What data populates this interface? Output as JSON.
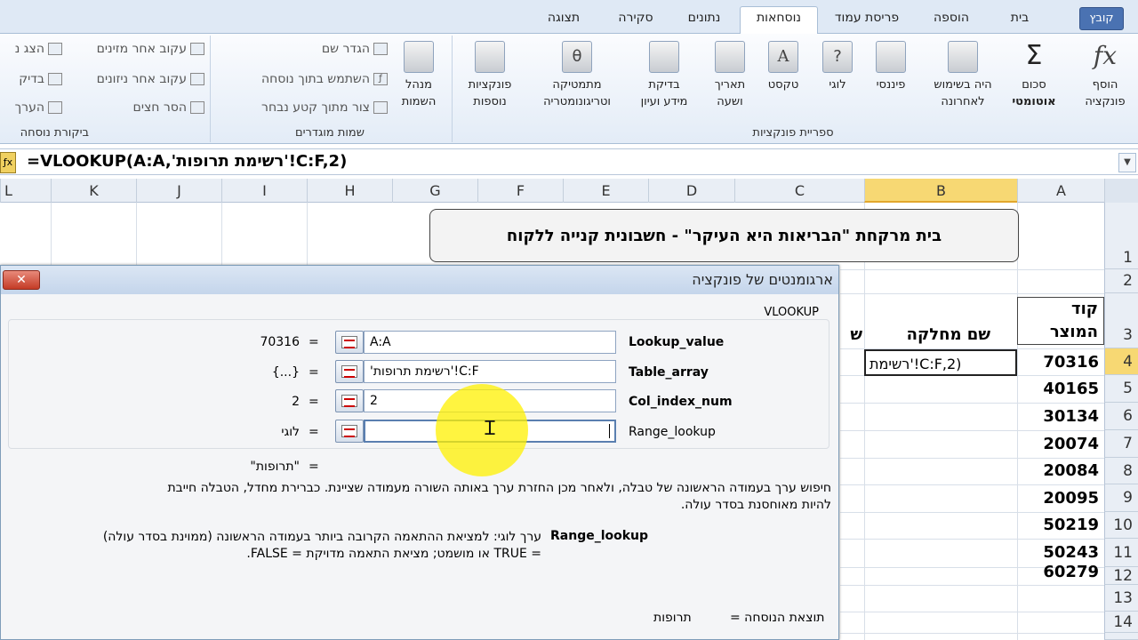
{
  "tabs": {
    "file": "קובץ",
    "items": [
      "בית",
      "הוספה",
      "פריסת עמוד",
      "נוסחאות",
      "נתונים",
      "סקירה",
      "תצוגה"
    ],
    "active": "נוסחאות"
  },
  "ribbon": {
    "function_library": {
      "label": "ספריית פונקציות",
      "buttons": [
        {
          "l1": "הוסף",
          "l2": "פונקציה",
          "icon": "fx"
        },
        {
          "l1": "סכום",
          "l2": "אוטומטי",
          "icon": "Σ"
        },
        {
          "l1": "היה בשימוש",
          "l2": "לאחרונה",
          "icon": "📖"
        },
        {
          "l1": "פיננסי",
          "l2": "",
          "icon": "📖"
        },
        {
          "l1": "לוגי",
          "l2": "",
          "icon": "?"
        },
        {
          "l1": "טקסט",
          "l2": "",
          "icon": "A"
        },
        {
          "l1": "תאריך",
          "l2": "ושעה",
          "icon": "📖"
        },
        {
          "l1": "בדיקת",
          "l2": "מידע ועיון",
          "icon": "🔍"
        },
        {
          "l1": "מתמטיקה",
          "l2": "וטריגונומטריה",
          "icon": "θ"
        },
        {
          "l1": "פונקציות",
          "l2": "נוספות",
          "icon": "📚"
        }
      ]
    },
    "defined_names": {
      "label": "שמות מוגדרים",
      "manager": {
        "l1": "מנהל",
        "l2": "השמות"
      },
      "items": [
        "הגדר שם",
        "השתמש בתוך נוסחה",
        "צור מתוך קטע נבחר"
      ]
    },
    "formula_auditing": {
      "label": "ביקורת נוסחה",
      "items": [
        "עקוב אחר מזינים",
        "עקוב אחר ניזונים",
        "הסר חצים"
      ],
      "partial": [
        "הצג נ",
        "בדיק",
        "הערך"
      ]
    }
  },
  "formula_bar": {
    "formula": "=VLOOKUP(A:A,'רשימת תרופות'!C:F,2)"
  },
  "grid": {
    "columns": [
      "A",
      "B",
      "C",
      "D",
      "E",
      "F",
      "G",
      "H",
      "I",
      "J",
      "K",
      "L"
    ],
    "selected_column": "B",
    "rows": [
      "1",
      "2",
      "3",
      "4",
      "5",
      "6",
      "7",
      "8",
      "9",
      "10",
      "11",
      "12",
      "13",
      "14"
    ],
    "selected_row": "4",
    "title": "בית מרקחת \"הבריאות היא העיקר\" - חשבונית קנייה ללקוח",
    "header_A": "קוד המוצר",
    "header_A1": "קוד",
    "header_A2": "המוצר",
    "header_B": "שם מחלקה",
    "header_C_partial": "ש",
    "b4_editing": "רשימת'!C:F,2)",
    "codes": [
      "70316",
      "40165",
      "30134",
      "20074",
      "20084",
      "20095",
      "50219",
      "50243",
      "60279"
    ]
  },
  "dialog": {
    "title": "ארגומנטים של פונקציה",
    "function_name": "VLOOKUP",
    "args": [
      {
        "name": "Lookup_value",
        "input": "A:A",
        "value": "70316",
        "bold": true
      },
      {
        "name": "Table_array",
        "input": "'רשימת תרופות'!C:F",
        "value": "{...}",
        "bold": true
      },
      {
        "name": "Col_index_num",
        "input": "2",
        "value": "2",
        "bold": true
      },
      {
        "name": "Range_lookup",
        "input": "",
        "value": "לוגי",
        "bold": false
      }
    ],
    "eq": "=",
    "preview_result": "\"תרופות\"",
    "description": "חיפוש ערך בעמודה הראשונה של טבלה, ולאחר מכן החזרת ערך באותה השורה מעמודה שציינת. כברירת מחדל, הטבלה חייבת להיות מאוחסנת בסדר עולה.",
    "desc_line1": "חיפוש ערך בעמודה הראשונה של טבלה, ולאחר מכן החזרת ערך באותה השורה מעמודה שציינת. כברירת מחדל, הטבלה חייבת",
    "desc_line2": "להיות מאוחסנת בסדר עולה.",
    "arg_help_name": "Range_lookup",
    "arg_help_line1": "ערך לוגי: למציאת ההתאמה הקרובה ביותר בעמודה הראשונה (ממוינת בסדר עולה)",
    "arg_help_line2": "= TRUE או מושמט; מציאת התאמה מדויקת = FALSE.",
    "result_label": "תוצאת הנוסחה =",
    "result_value": "תרופות",
    "close": "✕"
  }
}
